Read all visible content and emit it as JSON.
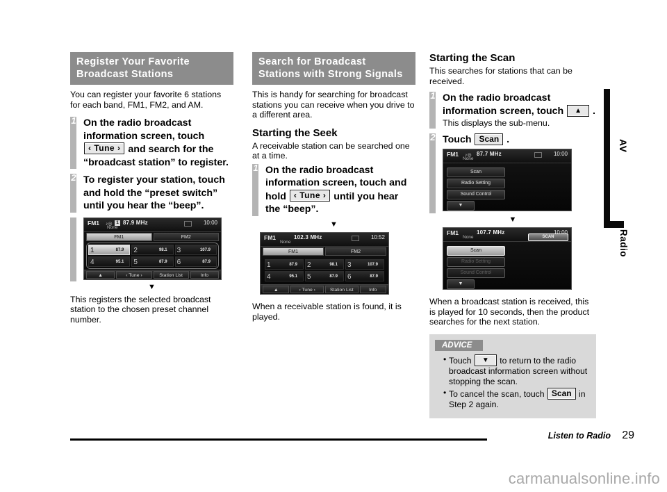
{
  "page": {
    "footer_label": "Listen to Radio",
    "page_number": "29",
    "watermark": "carmanualsonline.info",
    "side_tabs": {
      "primary": "AV",
      "secondary": "Radio"
    }
  },
  "col1": {
    "header_line1": "Register Your Favorite",
    "header_line2": "Broadcast Stations",
    "intro": "You can register your favorite 6 stations for each band, FM1, FM2, and AM.",
    "step1": {
      "num": "1",
      "part1": "On the radio broadcast information screen, touch",
      "key": "‹ Tune ›",
      "part2": "and search for the “broadcast station” to register."
    },
    "step2": {
      "num": "2",
      "text": "To register your station, touch and hold the “preset switch” until you hear the “beep”."
    },
    "arrow": "▼",
    "result": "This registers the selected broadcast station to the chosen preset channel number.",
    "device": {
      "band": "FM1",
      "speaker_icon": "speaker-icon",
      "preset_badge": "1",
      "frequency": "87.9 MHz",
      "station_name": "None",
      "time": "10:00",
      "tabs": [
        "FM1",
        "FM2"
      ],
      "active_tab": "FM1",
      "presets": [
        {
          "num": "1",
          "freq": "87.9",
          "selected": true
        },
        {
          "num": "2",
          "freq": "98.1",
          "selected": false
        },
        {
          "num": "3",
          "freq": "107.9",
          "selected": false
        },
        {
          "num": "4",
          "freq": "95.1",
          "selected": false
        },
        {
          "num": "5",
          "freq": "87.9",
          "selected": false
        },
        {
          "num": "6",
          "freq": "87.9",
          "selected": false
        }
      ],
      "bottom_keys": [
        "▲",
        "‹  Tune  ›",
        "Station List",
        "Info"
      ]
    }
  },
  "col2": {
    "header_line1": "Search for Broadcast",
    "header_line2": "Stations with Strong Signals",
    "intro": "This is handy for searching for broadcast stations you can receive when you drive to a different area.",
    "subhead": "Starting the Seek",
    "subintro": "A receivable station can be searched one at a time.",
    "step1": {
      "num": "1",
      "part1": "On the radio broadcast information screen, touch and hold",
      "key": "‹ Tune ›",
      "part2": "until you hear the “beep”."
    },
    "arrow": "▼",
    "result": "When a receivable station is found, it is played.",
    "device": {
      "band": "FM1",
      "frequency": "102.3 MHz",
      "station_name": "None",
      "time": "10:52",
      "tabs": [
        "FM1",
        "FM2"
      ],
      "active_tab": "FM1",
      "presets": [
        {
          "num": "1",
          "freq": "87.9",
          "selected": false
        },
        {
          "num": "2",
          "freq": "98.1",
          "selected": false
        },
        {
          "num": "3",
          "freq": "107.9",
          "selected": false
        },
        {
          "num": "4",
          "freq": "95.1",
          "selected": false
        },
        {
          "num": "5",
          "freq": "87.9",
          "selected": false
        },
        {
          "num": "6",
          "freq": "87.9",
          "selected": false
        }
      ],
      "bottom_keys": [
        "▲",
        "‹  Tune  ›",
        "Station List",
        "Info"
      ]
    }
  },
  "col3": {
    "subhead": "Starting the Scan",
    "intro": "This searches for stations that can be received.",
    "step1": {
      "num": "1",
      "part1": "On the radio broadcast information screen, touch",
      "key": "▲",
      "part2": ".",
      "note": "This displays the sub-menu."
    },
    "step2": {
      "num": "2",
      "part1": "Touch",
      "key": "Scan",
      "part2": "."
    },
    "arrow": "▼",
    "result": "When a broadcast station is received, this is played for 10 seconds, then the product searches for the next station.",
    "device1": {
      "band": "FM1",
      "speaker_icon": "speaker-icon",
      "frequency": "87.7 MHz",
      "station_name": "None",
      "time": "10:00",
      "menu_items": [
        "Scan",
        "Radio Setting",
        "Sound Control"
      ],
      "menu_more": "▼"
    },
    "device2": {
      "band": "FM1",
      "frequency": "107.7 MHz",
      "station_name": "None",
      "time": "10:00",
      "scan_badge": "SCAN",
      "menu_items": [
        "Scan",
        "Radio Setting",
        "Sound Control"
      ],
      "menu_more": "▼",
      "selected_item": "Scan"
    },
    "advice": {
      "title": "ADVICE",
      "item1_part1": "Touch",
      "item1_key": "▼",
      "item1_part2": "to return to the radio broadcast information screen without stopping the scan.",
      "item2_part1": "To cancel the scan, touch",
      "item2_key": "Scan",
      "item2_part2": "in Step 2 again."
    }
  }
}
